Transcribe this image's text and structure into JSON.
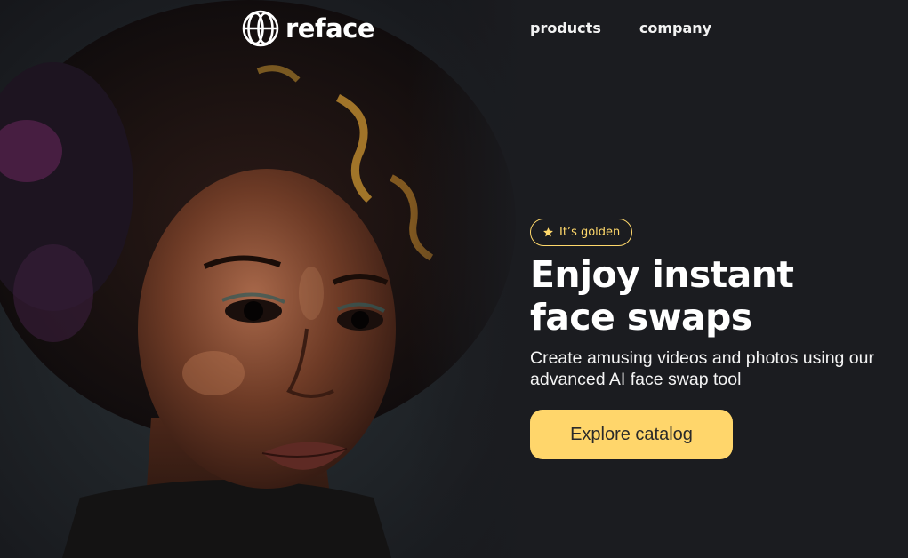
{
  "header": {
    "logo_text": "reface",
    "logo_icon": "reface-globe-icon",
    "nav": [
      {
        "label": "products"
      },
      {
        "label": "company"
      }
    ]
  },
  "hero": {
    "badge": {
      "icon": "star-icon",
      "label": "It’s golden"
    },
    "headline_line1": "Enjoy instant",
    "headline_line2": "face swaps",
    "subtext": "Create amusing videos and photos using our advanced AI face swap tool",
    "cta_label": "Explore catalog",
    "image": "portrait-photo"
  },
  "colors": {
    "background": "#1b1c20",
    "accent": "#ffd66b",
    "text": "#ffffff"
  }
}
